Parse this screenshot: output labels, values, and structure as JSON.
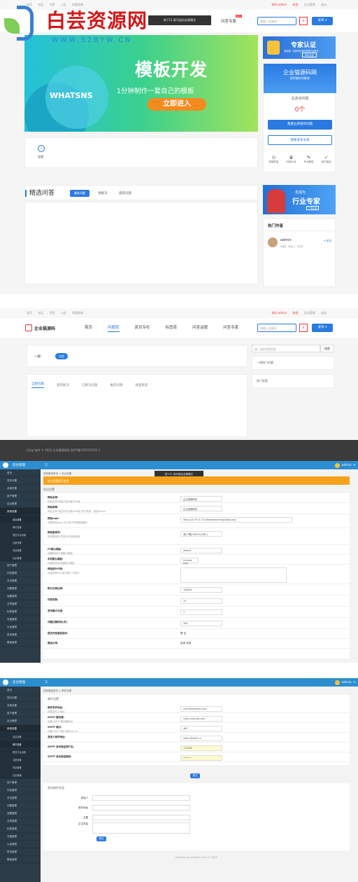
{
  "watermark": {
    "title": "白芸资源网",
    "url": "WWW.52BYW.CN"
  },
  "top": {
    "links": [
      "首页",
      "社区",
      "专家",
      "公告",
      "财富商城"
    ],
    "user": [
      "你好,admin",
      "私信",
      "后台管理",
      "退出"
    ],
    "toast": "按 F11 即可退出全屏模式"
  },
  "nav1": {
    "menu_tail": "问答专家",
    "badge": "NEW",
    "search_placeholder": "请输入关键词",
    "publish": "发布"
  },
  "banner": {
    "brand": "WHATSNS",
    "title": "模板开发",
    "subtitle": "1分钟制作一套自己的模板",
    "cta": "立即进入"
  },
  "expert_card": {
    "title": "专家认证",
    "text": "你还是一名软件位置专家吗?请填写",
    "btn": "申请认证"
  },
  "site_card": {
    "name": "企业猫源码网",
    "tagline": "提供最好的解答",
    "total_label": "总咨询问题",
    "total_value": "0个",
    "ask_btn": "我要立即发布问题",
    "article_btn": "我要发布文章",
    "features": [
      "快速答复",
      "问家认证",
      "专业解答",
      "官方保证"
    ]
  },
  "category": {
    "label": "全部"
  },
  "section": {
    "title": "精选问答",
    "tabs": [
      "最新问题",
      "待解决",
      "悬赏问题"
    ]
  },
  "expert_banner": {
    "line1": "去成为",
    "line2": "行业专家",
    "small": "一键入驻"
  },
  "hot": {
    "title": "热门作者",
    "name": "admin",
    "follow": "+关注",
    "meta": "0回答 · 粉丝 0 · 0文章"
  },
  "page2": {
    "links": [
      "首页",
      "社区",
      "专家",
      "公告",
      "财富商城"
    ],
    "user": [
      "你好,admin",
      "私信",
      "后台管理",
      "退出"
    ],
    "logo": "企业猫源码",
    "menu": [
      "首页",
      "问题库",
      "资讯专栏",
      "标签库",
      "问答话题",
      "问答专家"
    ],
    "search_placeholder": "请输入关键词",
    "publish": "发布",
    "side_search_placeholder": "搜一搜你想要答案",
    "side_search_btn": "搜索",
    "side_blocks": [
      "一周热门问题",
      "热门标签"
    ],
    "level_label": "一级:",
    "level_value": "全部",
    "tabs": [
      "全部问题",
      "悬赏解决",
      "已解决问题",
      "推荐问题",
      "财富悬赏"
    ],
    "footer": "Copyright © 2022 企业猫源码网 浙ICP备15032243号-1"
  },
  "admin1": {
    "logo": "后台管理",
    "toast": "按 F11 即可退出全屏模式",
    "user": "admin",
    "breadcrumb": "控制面板首页 > 站点设置",
    "notice": "站点设置提示信息",
    "section": "站点设置",
    "menu": [
      "首页",
      "发布问题",
      "全局设置",
      "用户管理",
      "站点管理",
      "系统设置",
      "站点设置",
      "邮件设置",
      "短信平台设置",
      "注册设置",
      "内容管理",
      "社区管理",
      "用户管理",
      "内容管理",
      "评论管理",
      "问题管理",
      "话题管理",
      "文章管理",
      "标签管理",
      "充值管理",
      "认证管理",
      "财务管理",
      "模板管理"
    ],
    "rows": [
      {
        "t": "网站名称:",
        "d": "网站名称,将显示在页面Title处",
        "v": "企业猫源码网"
      },
      {
        "t": "网站简称:",
        "d": "网站名称,将显示在页面Title处,用于导航、底部footer",
        "v": "企业猫源码网"
      },
      {
        "t": "网站logo:",
        "d": "设置网站logo,可以用达开客服接图片",
        "v": "https://47.97.4.172/data/attach/logo/logo.png"
      },
      {
        "t": "网站备案号:",
        "d": "网站备案号,将显示在页面底部",
        "v": "浙ICP备15032243号-1"
      },
      {
        "t": "PC默认模板:",
        "d": "设置网站PC端默认模板",
        "v": "default"
      },
      {
        "t": "手机默认模板:",
        "d": "设置网站手机端默认模板",
        "v": "fronted-wap"
      },
      {
        "t": "网站统计代码:",
        "d": "页面底部可以显示第三方统计",
        "v": ""
      },
      {
        "t": "积分兑换比例:",
        "d": "",
        "v": "100000"
      },
      {
        "t": "列表页数:",
        "d": "",
        "v": "15"
      },
      {
        "t": "发布最大长度:",
        "d": "",
        "v": "5"
      },
      {
        "t": "问题过期时间(天):",
        "d": "",
        "v": "300"
      },
      {
        "t": "是否开启游客提问:",
        "d": "",
        "v": "是 否"
      },
      {
        "t": "微信分享:",
        "d": "",
        "v": "启用 关闭"
      }
    ]
  },
  "admin2": {
    "logo": "后台管理",
    "user": "admin",
    "breadcrumb": "控制面板首页 > 邮件设置",
    "section": "邮件设置",
    "rows": [
      {
        "t": "邮件发件地址:",
        "d": "设置发件人地址",
        "v": "ask1@example.com"
      },
      {
        "t": "SMTP 服务器:",
        "d": "设置 SMTP 服务器地址",
        "v": "smtp.example.com"
      },
      {
        "t": "SMTP 端口:",
        "d": "设置 SMTP 端口,默认为 25",
        "v": "465"
      },
      {
        "t": "发送人邮件地址:",
        "d": "",
        "v": "admin@ask2.cn"
      },
      {
        "t": "SMTP 身份验证用户名:",
        "d": "",
        "v": "123456"
      },
      {
        "t": "SMTP 身份验证密码:",
        "d": "",
        "v": "••••••"
      }
    ],
    "submit": "提交",
    "test_section": "测试邮件发送",
    "test_rows": [
      {
        "t": "发送人",
        "v": ""
      },
      {
        "t": "收件地址",
        "v": ""
      },
      {
        "t": "主题",
        "v": ""
      },
      {
        "t": "正文内容",
        "v": ""
      }
    ],
    "test_btn": "提交",
    "footer": "Powered by whatsns V4.0 © 2022"
  }
}
